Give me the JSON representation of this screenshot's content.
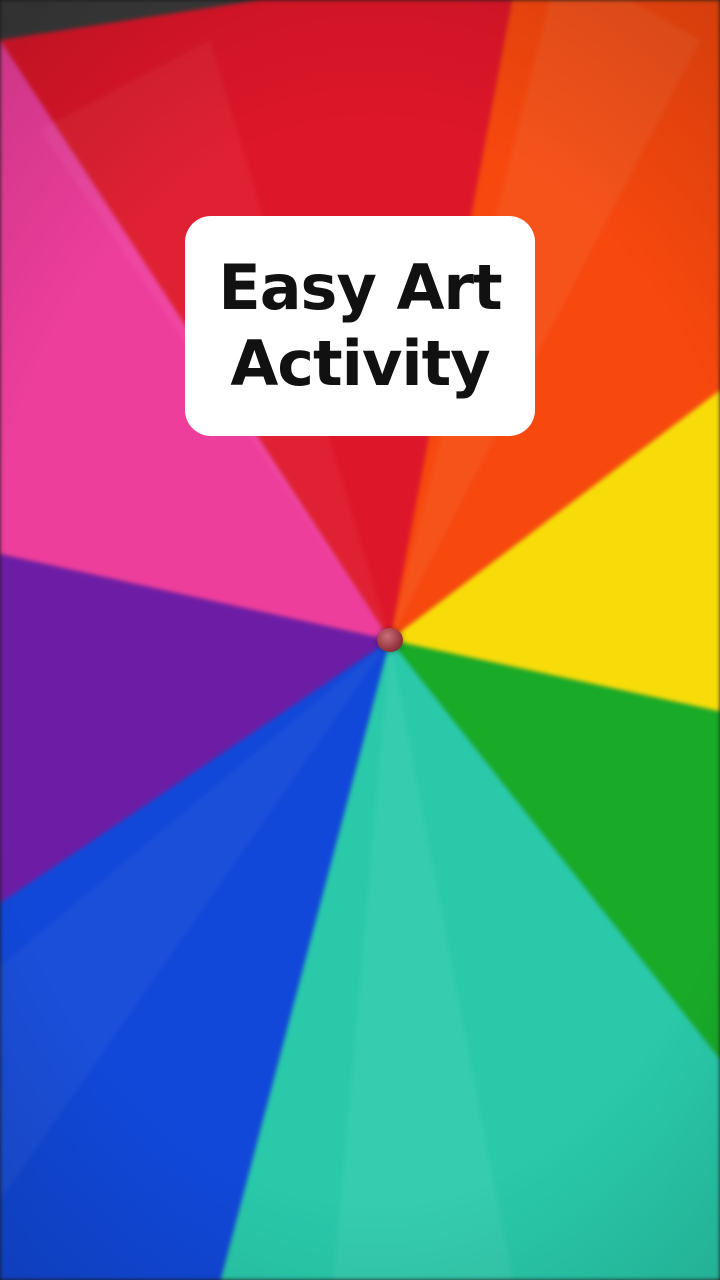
{
  "caption": {
    "line1": "Easy Art",
    "line2": "Activity"
  },
  "wheel_colors": {
    "red": "#d7182a",
    "orange": "#f04a12",
    "yellow": "#f6dc13",
    "green": "#1ea82c",
    "teal": "#2fc7aa",
    "blue": "#1448d2",
    "purple": "#6a1ea0",
    "pink": "#e8409a"
  }
}
